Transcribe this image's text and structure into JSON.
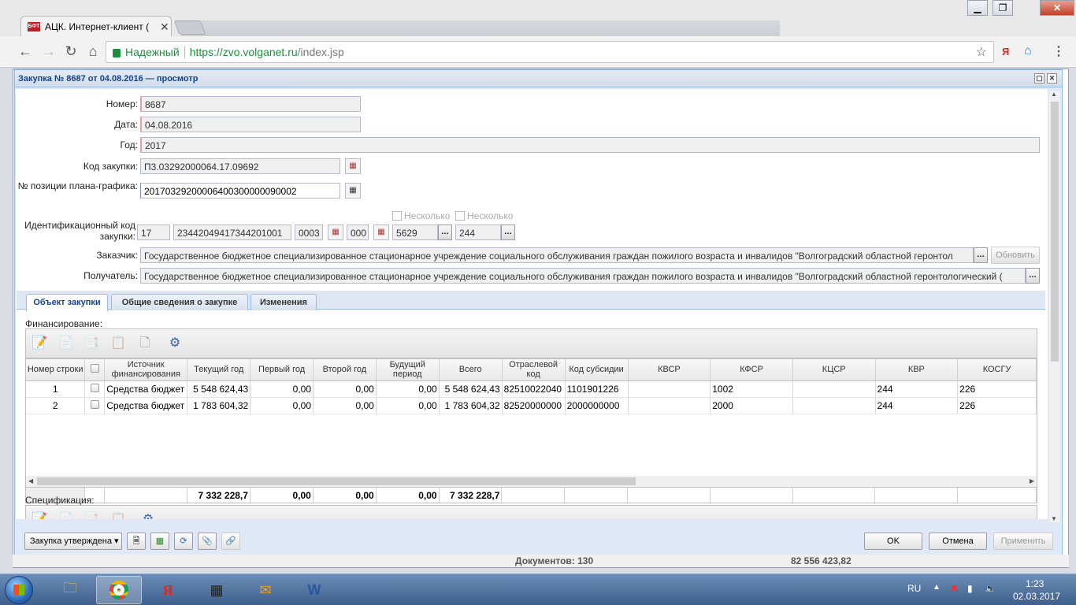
{
  "browser": {
    "tab_title": "АЦК. Интернет-клиент (",
    "tab_favicon_text": "БФТ",
    "omnibox": {
      "secure_label": "Надежный",
      "url_scheme_host": "https://zvo.volganet.ru",
      "url_path": "/index.jsp"
    },
    "ext_yandex": "Я"
  },
  "dialog": {
    "title": "Закупка № 8687 от 04.08.2016 — просмотр",
    "fields": {
      "number_label": "Номер:",
      "number_value": "8687",
      "date_label": "Дата:",
      "date_value": "04.08.2016",
      "year_label": "Год:",
      "year_value": "2017",
      "purchase_code_label": "Код закупки:",
      "purchase_code_value": "П3.03292000064.17.09692",
      "plan_position_label": "№ позиции плана-графика:",
      "plan_position_value": "20170329200006400300000090002",
      "multiple_1": "Несколько",
      "multiple_2": "Несколько",
      "ident_code_label": "Идентификационный код закупки:",
      "ident_code_parts": [
        "17",
        "23442049417344201001",
        "0003",
        "000",
        "5629",
        "244"
      ],
      "customer_label": "Заказчик:",
      "customer_value": "Государственное бюджетное специализированное стационарное учреждение социального обслуживания граждан пожилого возраста и инвалидов \"Волгоградский областной геронтол",
      "refresh_button": "Обновить",
      "recipient_label": "Получатель:",
      "recipient_value": "Государственное бюджетное специализированное стационарное учреждение социального обслуживания граждан пожилого возраста и инвалидов \"Волгоградский областной геронтологический ("
    },
    "tabs": [
      "Объект закупки",
      "Общие сведения о закупке",
      "Изменения"
    ],
    "financing_label": "Финансирование:",
    "spec_label": "Спецификация:",
    "grid": {
      "columns": [
        "Номер строки",
        "",
        "Источник финансирования",
        "Текущий год",
        "Первый год",
        "Второй год",
        "Будущий период",
        "Всего",
        "Отраслевой код",
        "Код субсидии",
        "КВСР",
        "КФСР",
        "КЦСР",
        "КВР",
        "КОСГУ"
      ],
      "rows": [
        [
          "1",
          "",
          "Средства бюджет",
          "5 548 624,43",
          "0,00",
          "0,00",
          "0,00",
          "5 548 624,43",
          "82510022040",
          "1101901226",
          "",
          "1002",
          "",
          "244",
          "226"
        ],
        [
          "2",
          "",
          "Средства бюджет",
          "1 783 604,32",
          "0,00",
          "0,00",
          "0,00",
          "1 783 604,32",
          "82520000000",
          "2000000000",
          "",
          "2000",
          "",
          "244",
          "226"
        ]
      ],
      "totals": [
        "",
        "",
        "",
        "7 332 228,7",
        "0,00",
        "0,00",
        "0,00",
        "7 332 228,7",
        "",
        "",
        "",
        "",
        "",
        "",
        ""
      ]
    },
    "footer": {
      "status_menu": "Закупка утверждена",
      "ok": "OK",
      "cancel": "Отмена",
      "apply": "Применить"
    }
  },
  "background_status": {
    "documents": "Документов: 130",
    "sum": "82 556 423,82"
  },
  "taskbar": {
    "lang": "RU",
    "time": "1:23",
    "date": "02.03.2017"
  },
  "colors": {
    "dialog_header_text": "#15428b",
    "secure_green": "#1e8e3e",
    "taskbar": "#4f72a3"
  }
}
